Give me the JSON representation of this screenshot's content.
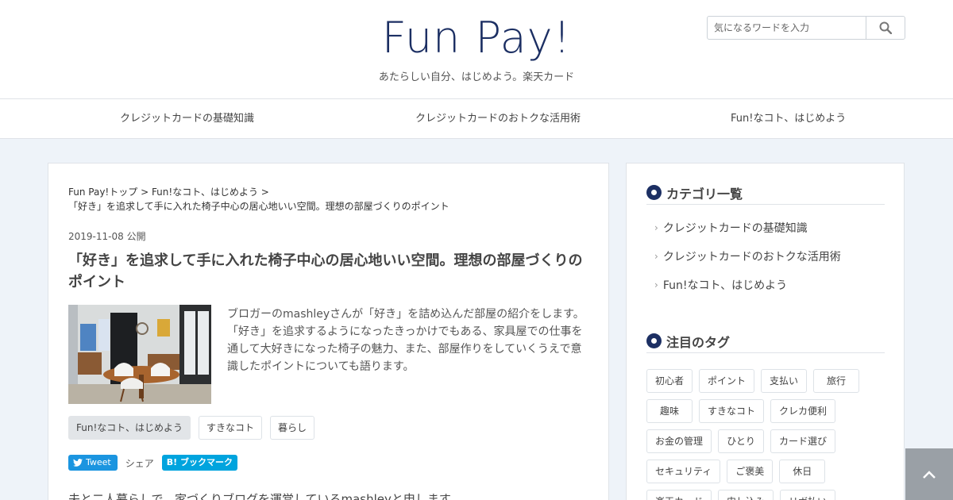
{
  "site": {
    "logo": "Fun Pay!",
    "tagline": "あたらしい自分、はじめよう。楽天カード"
  },
  "search": {
    "placeholder": "気になるワードを入力",
    "icon": "search-icon"
  },
  "nav": [
    "クレジットカードの基礎知識",
    "クレジットカードのおトクな活用術",
    "Fun!なコト、はじめよう"
  ],
  "article": {
    "breadcrumb": {
      "home": "Fun Pay!トップ",
      "sep": " > ",
      "category": "Fun!なコト、はじめよう",
      "current": "「好き」を追求して手に入れた椅子中心の居心地いい空間。理想の部屋づくりのポイント"
    },
    "date": "2019-11-08",
    "date_suffix": "公開",
    "title": "「好き」を追求して手に入れた椅子中心の居心地いい空間。理想の部屋づくりのポイント",
    "excerpt": "ブロガーのmashleyさんが「好き」を詰め込んだ部屋の紹介をします。「好き」を追求するようになったきっかけでもある、家具屋での仕事を通して大好きになった椅子の魅力、また、部屋作りをしていくうえで意識したポイントについても語ります。",
    "tags": [
      "Fun!なコト、はじめよう",
      "すきなコト",
      "暮らし"
    ],
    "share": {
      "tweet": "Tweet",
      "label": "シェア",
      "hatena": "B! ブックマーク"
    },
    "body_start": "夫と二人暮らしで、家づくりブログを運営しているmashleyと申します。"
  },
  "sidebar": {
    "categories_heading": "カテゴリ一覧",
    "categories": [
      "クレジットカードの基礎知識",
      "クレジットカードのおトクな活用術",
      "Fun!なコト、はじめよう"
    ],
    "tags_heading": "注目のタグ",
    "tags": [
      "初心者",
      "ポイント",
      "支払い",
      "旅行",
      "趣味",
      "すきなコト",
      "クレカ便利",
      "お金の管理",
      "ひとり",
      "カード選び",
      "セキュリティ",
      "ご褒美",
      "休日",
      "楽天カード",
      "申し込み",
      "リボ払い"
    ]
  },
  "colors": {
    "brand": "#1c2f63",
    "twitter": "#1b95e0",
    "hatena": "#00a4de",
    "page_bg": "#eef3f9"
  }
}
